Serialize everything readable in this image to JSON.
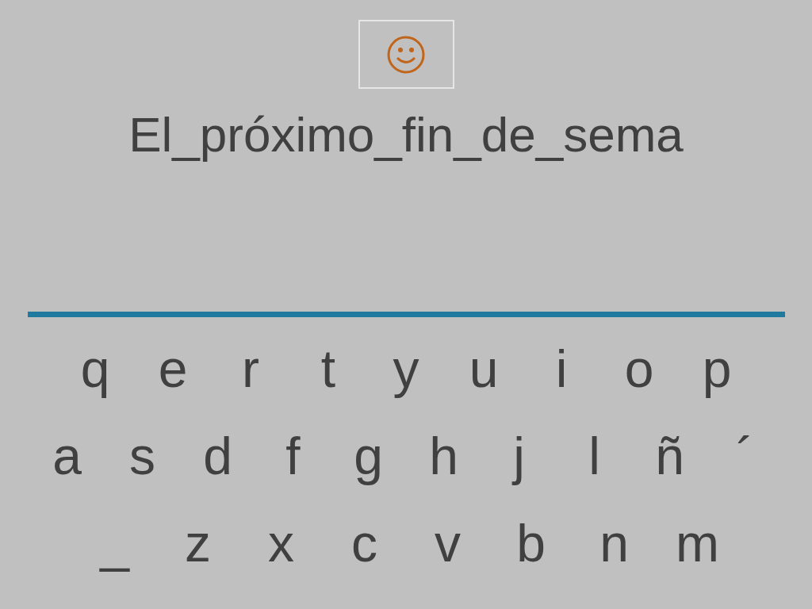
{
  "answer_text": "El_próximo_fin_de_sema",
  "keyboard": {
    "rows": [
      {
        "keys": [
          "q",
          "e",
          "r",
          "t",
          "y",
          "u",
          "i",
          "o",
          "p"
        ]
      },
      {
        "keys": [
          "a",
          "s",
          "d",
          "f",
          "g",
          "h",
          "j",
          "l",
          "ñ",
          "´"
        ]
      },
      {
        "keys": [
          "_",
          "z",
          "x",
          "c",
          "v",
          "b",
          "n",
          "m"
        ]
      }
    ]
  }
}
